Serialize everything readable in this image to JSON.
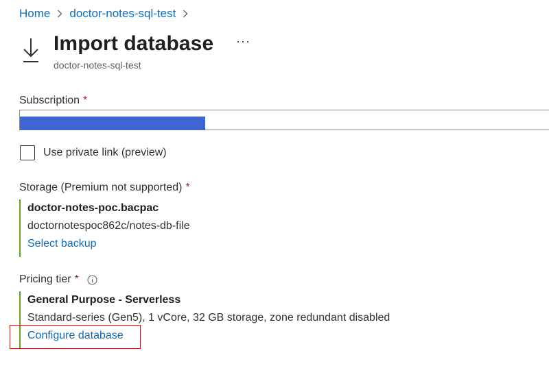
{
  "breadcrumb": {
    "home": "Home",
    "resource": "doctor-notes-sql-test"
  },
  "header": {
    "title": "Import database",
    "more_label": "···",
    "subtitle": "doctor-notes-sql-test",
    "icon": "download-icon"
  },
  "form": {
    "subscription": {
      "label": "Subscription",
      "required_mark": "*",
      "value_redacted": true
    },
    "private_link": {
      "label": "Use private link (preview)",
      "checked": false
    },
    "storage": {
      "label": "Storage (Premium not supported)",
      "required_mark": "*",
      "file_name": "doctor-notes-poc.bacpac",
      "path": "doctornotespoc862c/notes-db-file",
      "action": "Select backup"
    },
    "pricing_tier": {
      "label": "Pricing tier",
      "required_mark": "*",
      "tier_name": "General Purpose - Serverless",
      "details": "Standard-series (Gen5), 1 vCore, 32 GB storage, zone redundant disabled",
      "action": "Configure database"
    }
  },
  "colors": {
    "link": "#0f6cbd",
    "required": "#a4262c",
    "block_border": "#5ea11d",
    "redaction": "#3f64d3",
    "highlight": "#b02323"
  }
}
